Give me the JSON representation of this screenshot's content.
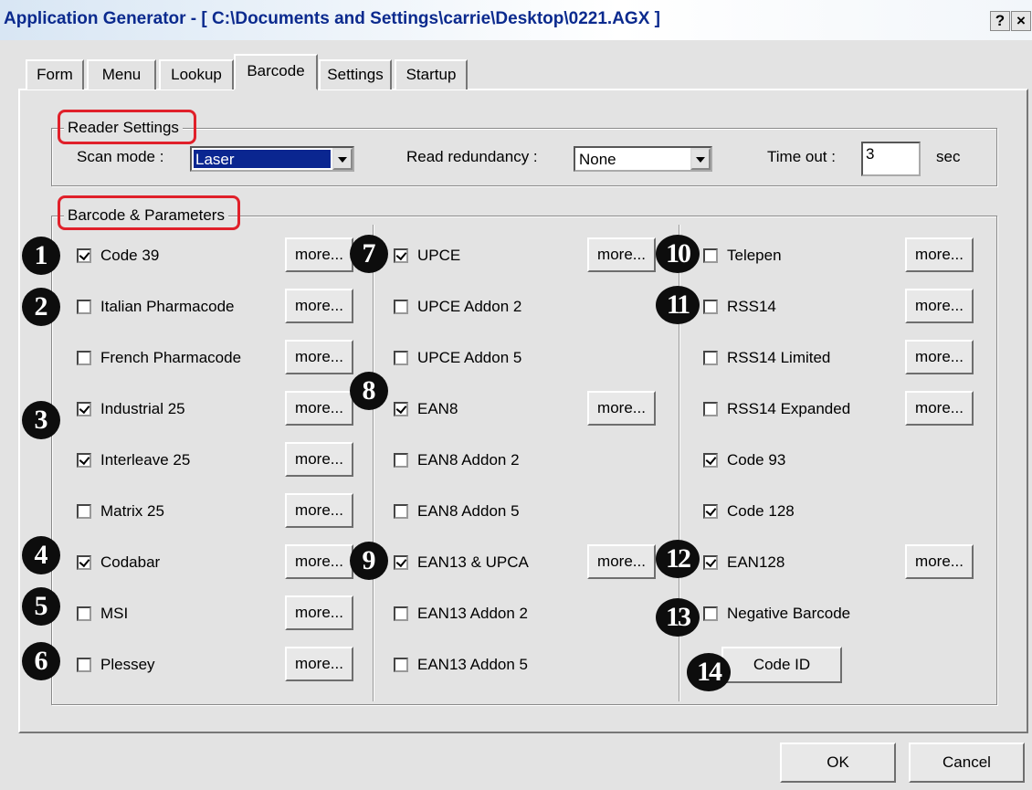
{
  "window": {
    "title": "Application Generator - [ C:\\Documents and Settings\\carrie\\Desktop\\0221.AGX ]",
    "help_btn": "?",
    "close_btn": "×"
  },
  "tabs": [
    "Form",
    "Menu",
    "Lookup",
    "Barcode",
    "Settings",
    "Startup"
  ],
  "active_tab": "Barcode",
  "reader_settings": {
    "legend": "Reader Settings",
    "scan_mode_label": "Scan mode :",
    "scan_mode_value": "Laser",
    "redundancy_label": "Read redundancy :",
    "redundancy_value": "None",
    "timeout_label": "Time out :",
    "timeout_value": "3",
    "timeout_unit": "sec"
  },
  "barcode_params": {
    "legend": "Barcode & Parameters",
    "more_label": "more...",
    "col1": [
      {
        "label": "Code 39",
        "checked": true,
        "more": true,
        "badge": "1"
      },
      {
        "label": "Italian  Pharmacode",
        "checked": false,
        "more": true,
        "badge": "2"
      },
      {
        "label": "French  Pharmacode",
        "checked": false,
        "more": true,
        "badge": ""
      },
      {
        "label": "Industrial 25",
        "checked": true,
        "more": true,
        "badge": "3"
      },
      {
        "label": "Interleave 25",
        "checked": true,
        "more": true,
        "badge": ""
      },
      {
        "label": "Matrix 25",
        "checked": false,
        "more": true,
        "badge": ""
      },
      {
        "label": "Codabar",
        "checked": true,
        "more": true,
        "badge": "4"
      },
      {
        "label": "MSI",
        "checked": false,
        "more": true,
        "badge": "5"
      },
      {
        "label": "Plessey",
        "checked": false,
        "more": true,
        "badge": "6"
      }
    ],
    "col2": [
      {
        "label": "UPCE",
        "checked": true,
        "more": true,
        "badge": "7"
      },
      {
        "label": "UPCE  Addon 2",
        "checked": false,
        "more": false,
        "badge": ""
      },
      {
        "label": "UPCE  Addon 5",
        "checked": false,
        "more": false,
        "badge": ""
      },
      {
        "label": "EAN8",
        "checked": true,
        "more": true,
        "badge": "8"
      },
      {
        "label": "EAN8  Addon 2",
        "checked": false,
        "more": false,
        "badge": ""
      },
      {
        "label": "EAN8  Addon 5",
        "checked": false,
        "more": false,
        "badge": ""
      },
      {
        "label": "EAN13  &  UPCA",
        "checked": true,
        "more": true,
        "badge": "9"
      },
      {
        "label": "EAN13  Addon 2",
        "checked": false,
        "more": false,
        "badge": ""
      },
      {
        "label": "EAN13  Addon 5",
        "checked": false,
        "more": false,
        "badge": ""
      }
    ],
    "col3": [
      {
        "label": "Telepen",
        "checked": false,
        "more": true,
        "badge": "10"
      },
      {
        "label": "RSS14",
        "checked": false,
        "more": true,
        "badge": "11"
      },
      {
        "label": "RSS14 Limited",
        "checked": false,
        "more": true,
        "badge": ""
      },
      {
        "label": "RSS14 Expanded",
        "checked": false,
        "more": true,
        "badge": ""
      },
      {
        "label": "Code 93",
        "checked": true,
        "more": false,
        "badge": ""
      },
      {
        "label": "Code 128",
        "checked": true,
        "more": false,
        "badge": ""
      },
      {
        "label": "EAN128",
        "checked": true,
        "more": true,
        "badge": "12"
      },
      {
        "label": "Negative Barcode",
        "checked": false,
        "more": false,
        "badge": "13"
      }
    ],
    "code_id_label": "Code ID",
    "code_id_badge": "14"
  },
  "footer": {
    "ok": "OK",
    "cancel": "Cancel"
  }
}
